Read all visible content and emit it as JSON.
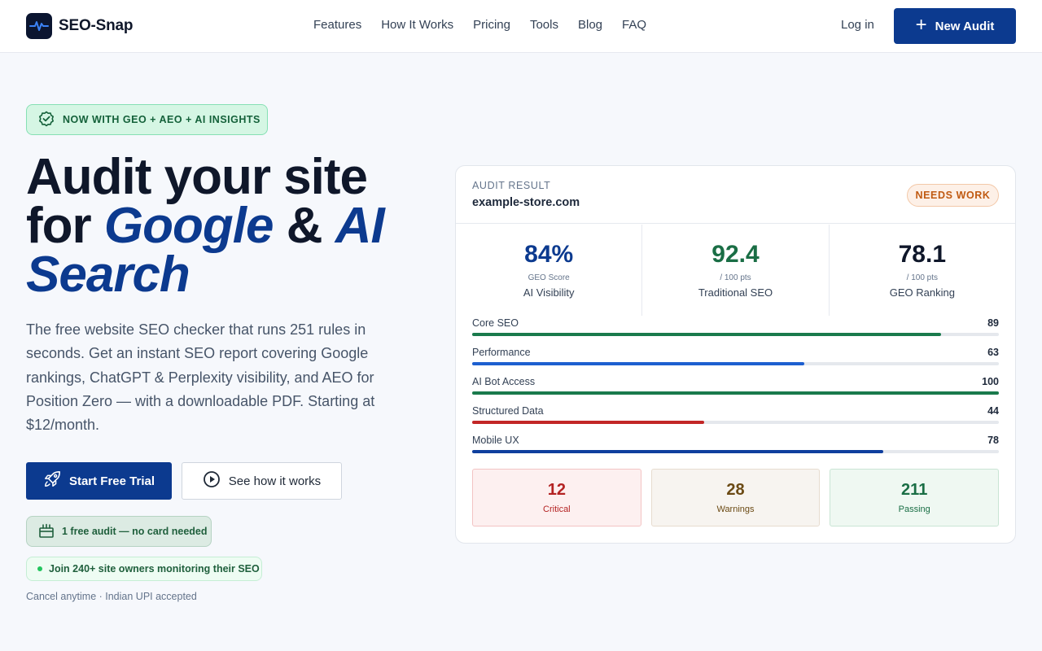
{
  "brand": {
    "name": "SEO-Snap"
  },
  "nav": {
    "links": [
      "Features",
      "How It Works",
      "Pricing",
      "Tools",
      "Blog",
      "FAQ"
    ],
    "login": "Log in",
    "cta": "New Audit"
  },
  "hero": {
    "badge": "NOW WITH GEO + AEO + AI INSIGHTS",
    "headline_1": "Audit your site",
    "headline_2a": "for",
    "headline_2b": "Google",
    "headline_2c": "&",
    "headline_2d": "AI",
    "headline_3": "Search",
    "lead": "The free website SEO checker that runs 251 rules in seconds. Get an instant SEO report covering Google rankings, ChatGPT & Perplexity visibility, and AEO for Position Zero — with a downloadable PDF. Starting at $12/month.",
    "primary_cta": "Start Free Trial",
    "secondary_cta": "See how it works",
    "free_audit": "1 free audit — no card needed",
    "social_proof": "Join 240+ site owners monitoring their SEO",
    "fine_print": "Cancel anytime · Indian UPI accepted"
  },
  "audit": {
    "label": "AUDIT RESULT",
    "domain": "example-store.com",
    "status": "NEEDS WORK",
    "metrics": [
      {
        "value": "84%",
        "sub": "GEO Score",
        "label": "AI Visibility",
        "color": "#0c3a8f"
      },
      {
        "value": "92.4",
        "sub": "/ 100 pts",
        "label": "Traditional SEO",
        "color": "#1a6e45"
      },
      {
        "value": "78.1",
        "sub": "/ 100 pts",
        "label": "GEO Ranking",
        "color": "#0f172a"
      }
    ],
    "categories": [
      {
        "label": "Core SEO",
        "score": 89,
        "color": "#1a7a4c"
      },
      {
        "label": "Performance",
        "score": 63,
        "color": "#1d5fd0"
      },
      {
        "label": "AI Bot Access",
        "score": 100,
        "color": "#1a7a4c"
      },
      {
        "label": "Structured Data",
        "score": 44,
        "color": "#c22626"
      },
      {
        "label": "Mobile UX",
        "score": 78,
        "color": "#0f3f9e"
      }
    ],
    "summary": [
      {
        "count": "12",
        "label": "Critical",
        "color": "#b42323"
      },
      {
        "count": "28",
        "label": "Warnings",
        "color": "#6b4a14"
      },
      {
        "count": "211",
        "label": "Passing",
        "color": "#1a6e45"
      }
    ]
  }
}
